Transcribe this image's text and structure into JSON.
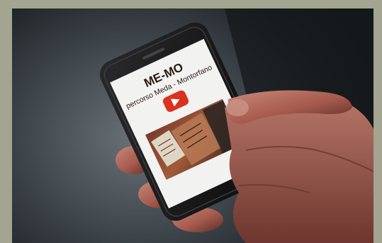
{
  "phone_screen": {
    "title": "ME-MO",
    "subtitle": "percorso Meda - Montorfano"
  },
  "colors": {
    "frame": "#a4a590",
    "screen_bg": "#f2f2f0",
    "play_button": "#d9321f",
    "title_text": "#2a1a12"
  },
  "icons": [
    "play-button-icon"
  ]
}
